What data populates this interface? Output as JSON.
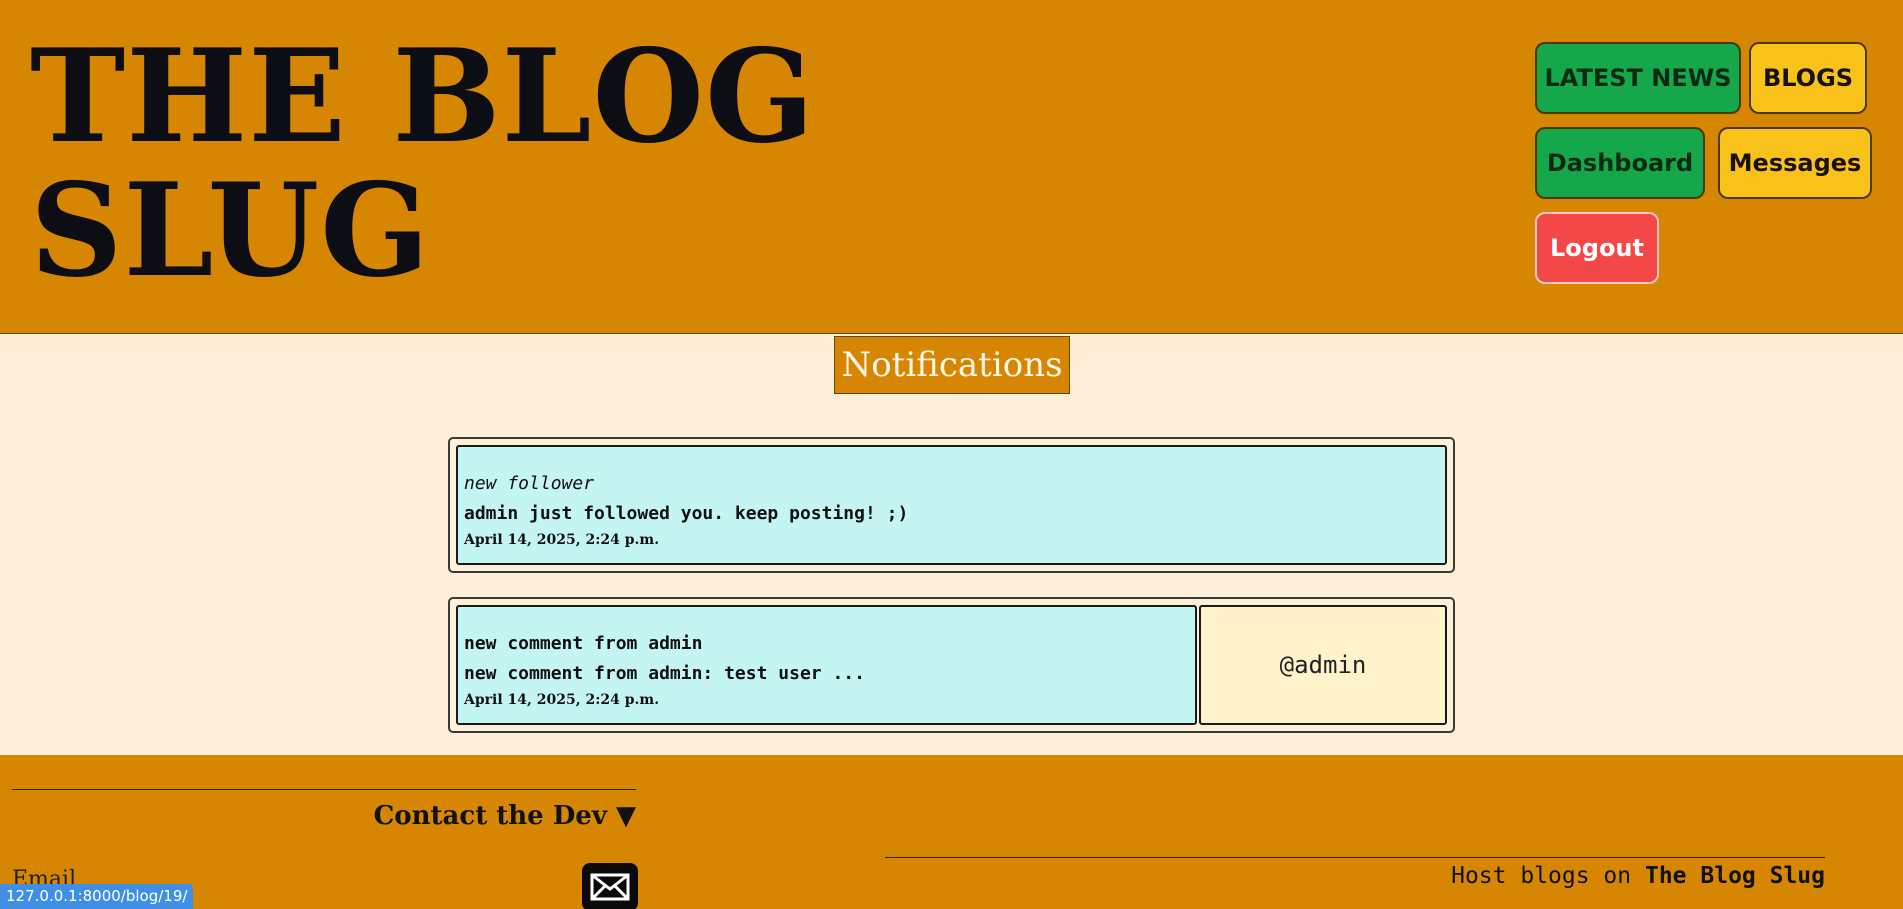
{
  "header": {
    "title_line1": "THE BLOG",
    "title_line2": "SLUG",
    "nav": {
      "latest_news": "LATEST NEWS",
      "blogs": "BLOGS",
      "dashboard": "Dashboard",
      "messages": "Messages",
      "logout": "Logout"
    }
  },
  "main": {
    "heading": "Notifications",
    "notifications": [
      {
        "type": "new follower",
        "message": "admin just followed you. keep posting! ;)",
        "date": "April 14, 2025, 2:24 p.m."
      },
      {
        "type": "new comment from admin",
        "message": "new comment from admin: test user ...",
        "date": "April 14, 2025, 2:24 p.m.",
        "user": "@admin"
      }
    ]
  },
  "footer": {
    "contact_title": "Contact the Dev ▼",
    "email_label": "Email",
    "host_prefix": "Host blogs on ",
    "host_brand": "The Blog Slug"
  },
  "status_bar": {
    "url": "127.0.0.1:8000/blog/19/"
  },
  "colors": {
    "header_bg": "#d68600",
    "page_bg": "#fdefd8",
    "card_bg": "#c4f5f2",
    "green_button": "#14a84a",
    "yellow_button": "#f8c21a",
    "red_button": "#f44848"
  },
  "icons": {
    "mail": "envelope-icon"
  }
}
